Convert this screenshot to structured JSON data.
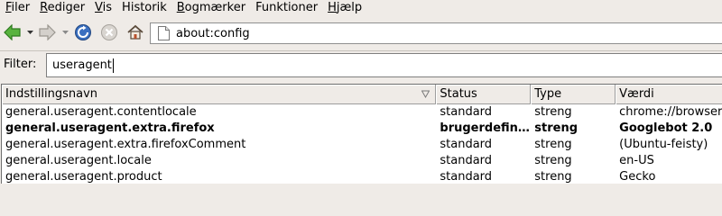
{
  "menubar": {
    "items": [
      {
        "key": "F",
        "rest": "iler"
      },
      {
        "key": "R",
        "rest": "ediger"
      },
      {
        "key": "V",
        "rest": "is"
      },
      {
        "key": "H",
        "pre": "",
        "rest": "istorik",
        "underline_index": 1
      },
      {
        "key": "B",
        "rest": "ogmærker"
      },
      {
        "key": "F",
        "pre": "",
        "rest": "unktioner",
        "underline_index": 1
      },
      {
        "key": "H",
        "rest": "jælp"
      }
    ]
  },
  "toolbar": {
    "back_icon": "back-arrow-icon",
    "forward_icon": "forward-arrow-icon",
    "reload_icon": "reload-icon",
    "stop_icon": "stop-icon",
    "home_icon": "home-icon"
  },
  "urlbar": {
    "value": "about:config",
    "icon": "page-icon"
  },
  "filter": {
    "label": "Filter:",
    "value": "useragent"
  },
  "table": {
    "columns": [
      "Indstillingsnavn",
      "Status",
      "Type",
      "Værdi"
    ],
    "rows": [
      {
        "name": "general.useragent.contentlocale",
        "status": "standard",
        "type": "streng",
        "value": "chrome://browser/",
        "bold": false
      },
      {
        "name": "general.useragent.extra.firefox",
        "status": "brugerdefin...",
        "type": "streng",
        "value": "Googlebot 2.0",
        "bold": true
      },
      {
        "name": "general.useragent.extra.firefoxComment",
        "status": "standard",
        "type": "streng",
        "value": "(Ubuntu-feisty)",
        "bold": false
      },
      {
        "name": "general.useragent.locale",
        "status": "standard",
        "type": "streng",
        "value": "en-US",
        "bold": false
      },
      {
        "name": "general.useragent.product",
        "status": "standard",
        "type": "streng",
        "value": "Gecko",
        "bold": false
      }
    ]
  },
  "colors": {
    "chrome_bg": "#efebe7",
    "back_green": "#3e9a2a",
    "reload_blue": "#3a6fc0"
  }
}
